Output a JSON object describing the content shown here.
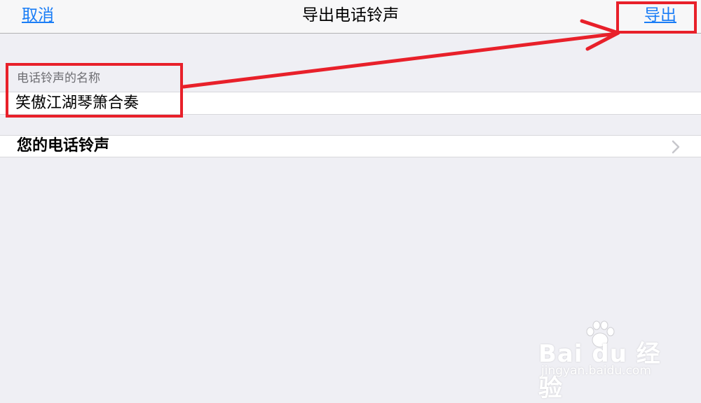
{
  "navbar": {
    "cancel_label": "取消",
    "title": "导出电话铃声",
    "export_label": "导出"
  },
  "form": {
    "section_header": "电话铃声的名称",
    "ringtone_name_value": "笑傲江湖琴箫合奏"
  },
  "list": {
    "your_ringtones_label": "您的电话铃声",
    "chevron_icon": "chevron-right-icon"
  },
  "annotations": {
    "color": "#e8202a"
  },
  "watermark": {
    "logo_text": "Bai  du 经验",
    "url": "jingyan.baidu.com"
  },
  "colors": {
    "accent": "#1a7df6",
    "background": "#efeff4"
  }
}
